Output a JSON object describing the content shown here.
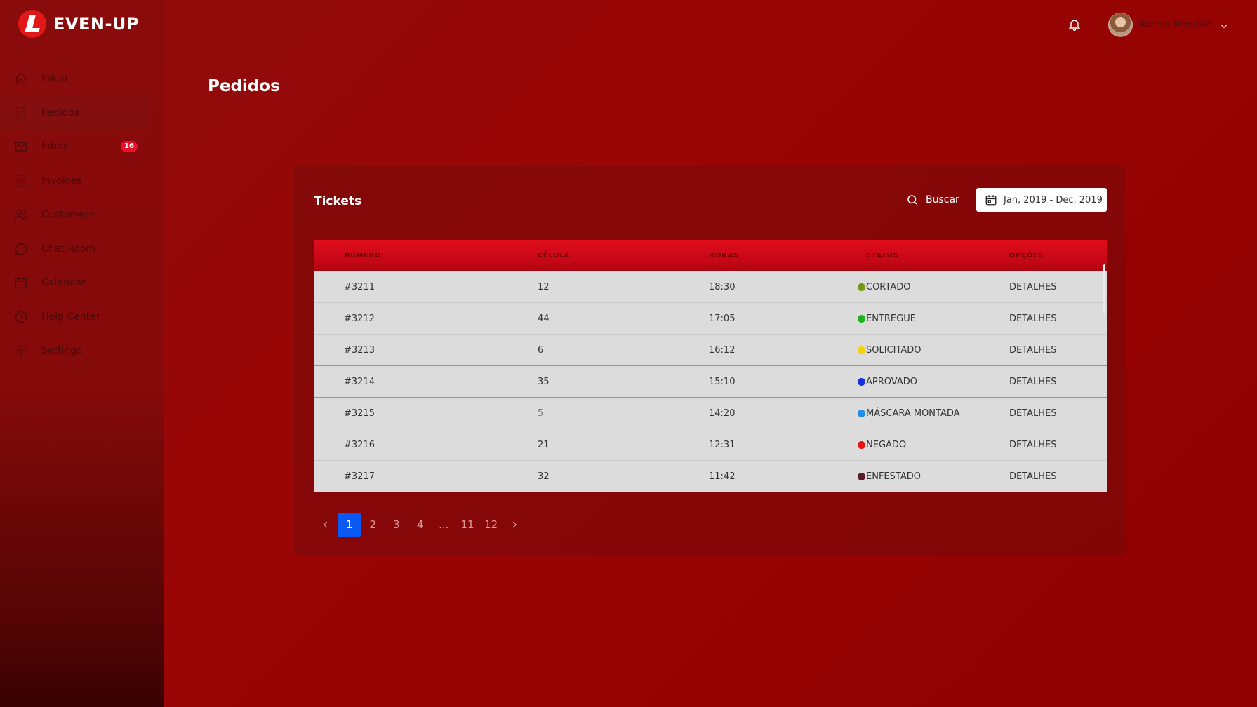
{
  "app": {
    "logo_text": "EVEN-UP",
    "brand_color": "#e01818"
  },
  "sidebar": {
    "items": [
      {
        "label": "Início",
        "icon": "home-icon"
      },
      {
        "label": "Pedidos",
        "icon": "document-icon",
        "active": true
      },
      {
        "label": "Inbox",
        "icon": "mail-icon",
        "badge": "16"
      },
      {
        "label": "Invoices",
        "icon": "invoice-icon"
      },
      {
        "label": "Customers",
        "icon": "users-icon"
      },
      {
        "label": "Chat Room",
        "icon": "chat-icon"
      },
      {
        "label": "Calendar",
        "icon": "calendar-icon"
      },
      {
        "label": "Help Center",
        "icon": "help-icon"
      },
      {
        "label": "Settings",
        "icon": "gear-icon"
      }
    ]
  },
  "header": {
    "user_name": "Ronnie Woodkin"
  },
  "page": {
    "title": "Pedidos"
  },
  "card": {
    "title": "Tickets",
    "search_label": "Buscar",
    "date_range": "Jan, 2019 - Dec, 2019"
  },
  "table": {
    "columns": [
      "NÚMERO",
      "CÉLULA",
      "HORAS",
      "STATUS",
      "OPÇÕES"
    ],
    "rows": [
      {
        "numero": "#3211",
        "celula": "12",
        "horas": "18:30",
        "status": "CORTADO",
        "status_color": "#6f9a12",
        "opcao": "DETALHES"
      },
      {
        "numero": "#3212",
        "celula": "44",
        "horas": "17:05",
        "status": "ENTREGUE",
        "status_color": "#1fb01f",
        "opcao": "DETALHES"
      },
      {
        "numero": "#3213",
        "celula": "6",
        "horas": "16:12",
        "status": "SOLICITADO",
        "status_color": "#f2d20e",
        "opcao": "DETALHES"
      },
      {
        "numero": "#3214",
        "celula": "35",
        "horas": "15:10",
        "status": "APROVADO",
        "status_color": "#1430e0",
        "opcao": "DETALHES"
      },
      {
        "numero": "#3215",
        "celula": "5",
        "horas": "14:20",
        "status": "MÁSCARA MONTADA",
        "status_color": "#1e8ee8",
        "opcao": "DETALHES"
      },
      {
        "numero": "#3216",
        "celula": "21",
        "horas": "12:31",
        "status": "NEGADO",
        "status_color": "#e81010",
        "opcao": "DETALHES"
      },
      {
        "numero": "#3217",
        "celula": "32",
        "horas": "11:42",
        "status": "ENFESTADO",
        "status_color": "#5a1a2a",
        "opcao": "DETALHES"
      }
    ]
  },
  "pagination": {
    "pages": [
      "1",
      "2",
      "3",
      "4",
      "...",
      "11",
      "12"
    ],
    "current": "1"
  }
}
